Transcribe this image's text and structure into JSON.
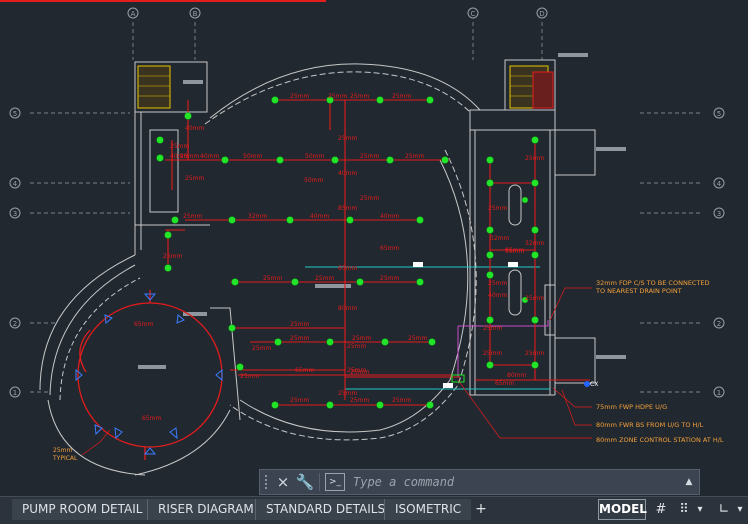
{
  "drawing": {
    "pipe_labels_top": [
      "25mm",
      "25mm",
      "25mm",
      "25mm"
    ],
    "pipe_labels": [
      "25mm",
      "40mm",
      "50mm",
      "50mm",
      "25mm",
      "25mm",
      "25mm",
      "50mm",
      "25mm",
      "25mm",
      "32mm",
      "40mm",
      "40mm",
      "25mm",
      "25mm",
      "65mm",
      "25mm",
      "25mm",
      "25mm",
      "25mm",
      "25mm",
      "25mm",
      "25mm",
      "25mm",
      "25mm",
      "25mm",
      "25mm",
      "65mm",
      "25mm",
      "25mm",
      "25mm",
      "40mm",
      "65mm",
      "25mm",
      "80mm",
      "40mm",
      "25mm",
      "65mm",
      "32mm",
      "25mm",
      "25mm",
      "32mm",
      "25mm",
      "25mm",
      "40mm",
      "85mm",
      "80mm",
      "50mm",
      "25mm",
      "25mm",
      "25mm",
      "25mm",
      "40mm",
      "65mm"
    ],
    "ring_labels": {
      "top": "65mm",
      "bottom": "65mm",
      "typical_size": "25mm",
      "typical": "TYPICAL"
    },
    "right_labels": {
      "pipe_80": "80mm",
      "pipe_50": "50mm",
      "cx": "CX"
    },
    "notes": [
      "32mm FDP C/S TO BE CONNECTED",
      "TO NEAREST DRAIN POINT",
      "75mm FWP HDPE U/G",
      "80mm FWR BS FROM U/G TO H/L",
      "80mm ZONE CONTROL STATION AT H/L"
    ],
    "grid_markers_left": [
      "5",
      "4",
      "3",
      "2",
      "1"
    ],
    "grid_markers_right": [
      "5",
      "4",
      "3",
      "2",
      "1"
    ],
    "grid_markers_top": [
      "A",
      "B",
      "C",
      "D"
    ]
  },
  "command_line": {
    "placeholder": "Type a command",
    "close_icon": "×",
    "settings_icon": "🔧",
    "prompt_icon": ">_",
    "caret": "▲"
  },
  "layout_tabs": [
    "PUMP ROOM DETAIL",
    "RISER DIAGRAM",
    "STANDARD DETAILS",
    "ISOMETRIC"
  ],
  "add_tab": "+",
  "status": {
    "model": "MODEL",
    "grid_icon": "#",
    "snap_icon": "⠿",
    "snap_dropdown": "▾",
    "ortho_icon": "∟",
    "more_dropdown": "▾"
  },
  "colors": {
    "background": "#212830",
    "pipe": "#e31c1c",
    "sprinkler": "#22e52a",
    "wall": "#c8c8c8",
    "cyan_line": "#25c9c9",
    "magenta_line": "#c94bc9",
    "note_text": "#f4a13a"
  }
}
